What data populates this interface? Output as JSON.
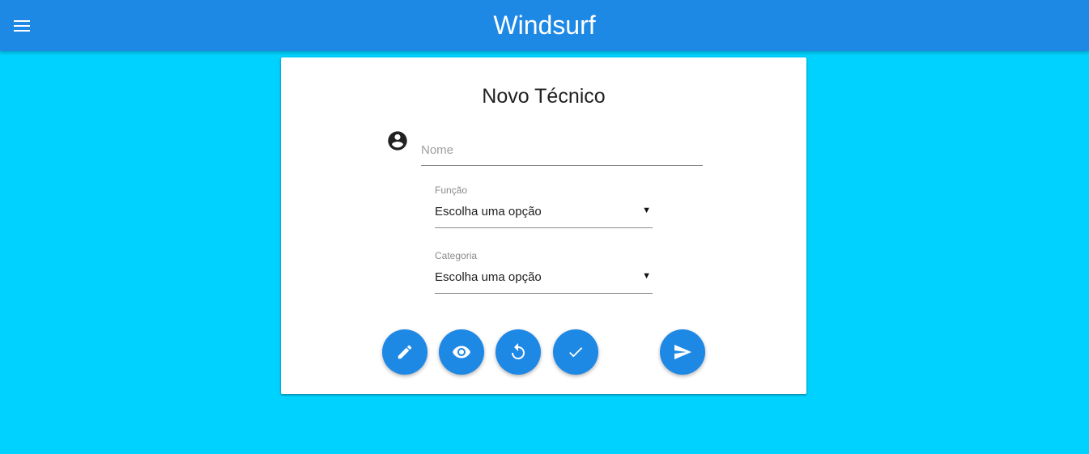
{
  "app": {
    "title": "Windsurf"
  },
  "form": {
    "title": "Novo Técnico",
    "name_placeholder": "Nome",
    "funcao": {
      "label": "Função",
      "selected": "Escolha uma opção"
    },
    "categoria": {
      "label": "Categoria",
      "selected": "Escolha uma opção"
    }
  },
  "actions": [
    {
      "icon": "pencil-icon"
    },
    {
      "icon": "eye-icon"
    },
    {
      "icon": "undo-icon"
    },
    {
      "icon": "check-icon"
    },
    {
      "icon": "send-icon"
    }
  ],
  "colors": {
    "primary": "#1e88e5",
    "background": "#00d2ff",
    "card": "#ffffff"
  }
}
